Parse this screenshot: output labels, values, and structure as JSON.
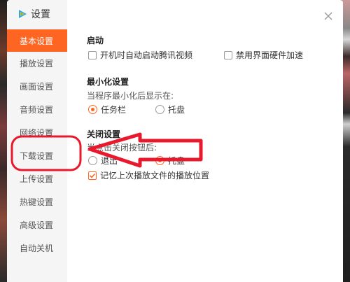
{
  "app_title": "设置",
  "close_symbol": "×",
  "sidebar": {
    "items": [
      {
        "label": "基本设置",
        "active": true
      },
      {
        "label": "播放设置",
        "active": false
      },
      {
        "label": "画面设置",
        "active": false
      },
      {
        "label": "音频设置",
        "active": false
      },
      {
        "label": "网络设置",
        "active": false
      },
      {
        "label": "下载设置",
        "active": false
      },
      {
        "label": "上传设置",
        "active": false
      },
      {
        "label": "热键设置",
        "active": false
      },
      {
        "label": "高级设置",
        "active": false
      },
      {
        "label": "自动关机",
        "active": false
      }
    ]
  },
  "startup": {
    "title": "启动",
    "autostart_label": "开机时自动启动腾讯视频",
    "autostart_checked": false,
    "hw_accel_label": "禁用界面硬件加速",
    "hw_accel_checked": false
  },
  "minimize": {
    "title": "最小化设置",
    "hint": "当程序最小化后显示在:",
    "taskbar_label": "任务栏",
    "taskbar_selected": true,
    "tray_label": "托盘",
    "tray_selected": false
  },
  "close_settings": {
    "title": "关闭设置",
    "hint": "当点击关闭按钮后:",
    "exit_label": "退出",
    "exit_selected": false,
    "tray_label": "托盘",
    "tray_selected": true,
    "remember_label": "记忆上次播放文件的播放位置",
    "remember_checked": true
  },
  "colors": {
    "accent": "#ff6522",
    "annotation_red": "#e8192c",
    "sidebar_bg": "#f5f5f5"
  }
}
